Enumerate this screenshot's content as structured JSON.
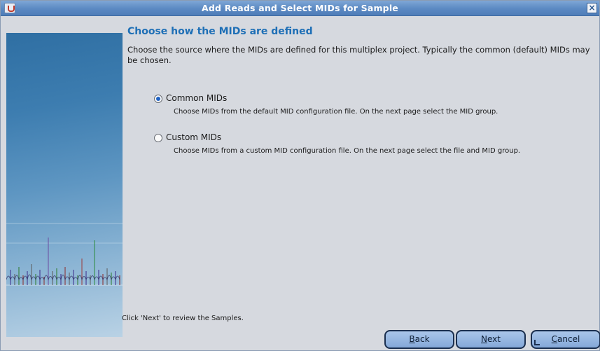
{
  "window": {
    "title": "Add Reads and Select MIDs for Sample",
    "close_symbol": "×"
  },
  "icons": {
    "app": "java-coffee-cup-icon",
    "close": "close-icon"
  },
  "colors": {
    "titlebar": "#5b89c2",
    "heading": "#1e6fb6",
    "background": "#d6d9df",
    "button": "#9ab9e4"
  },
  "page": {
    "heading": "Choose how the MIDs are defined",
    "description": "Choose the source where the MIDs are defined for this multiplex project. Typically the common (default) MIDs may be chosen."
  },
  "options": [
    {
      "label": "Common MIDs",
      "description": "Choose MIDs from the default MID configuration file. On the next page select the MID group.",
      "selected": true
    },
    {
      "label": "Custom MIDs",
      "description": "Choose MIDs from a custom MID configuration file. On the next page select the file and MID group.",
      "selected": false
    }
  ],
  "footer": {
    "hint": "Click 'Next' to review the Samples."
  },
  "buttons": {
    "back": {
      "mnemonic": "B",
      "rest": "ack"
    },
    "next": {
      "mnemonic": "N",
      "rest": "ext"
    },
    "cancel": {
      "mnemonic": "C",
      "rest": "ancel"
    }
  }
}
